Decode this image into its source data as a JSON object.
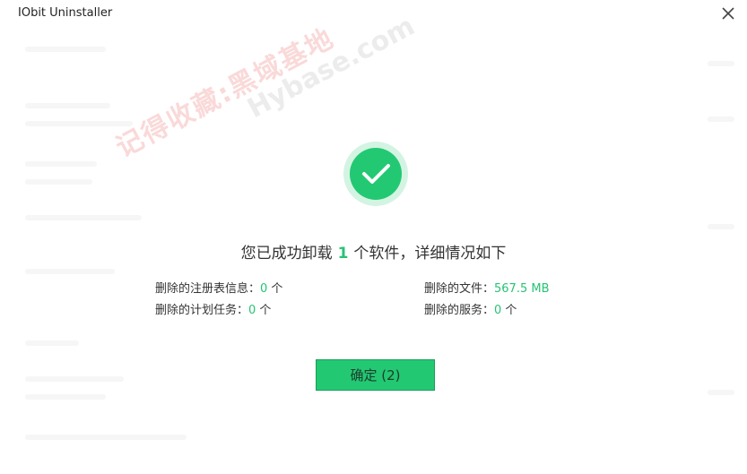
{
  "window": {
    "title": "IObit Uninstaller"
  },
  "result": {
    "prefix": "您已成功卸载",
    "count": "1",
    "suffix": "个软件，详细情况如下"
  },
  "stats": {
    "registry": {
      "label": "删除的注册表信息：",
      "value": "0",
      "unit": " 个"
    },
    "files": {
      "label": "删除的文件：",
      "value": "567.5 MB",
      "unit": ""
    },
    "tasks": {
      "label": "删除的计划任务：",
      "value": "0",
      "unit": " 个"
    },
    "services": {
      "label": "删除的服务：",
      "value": "0",
      "unit": " 个"
    }
  },
  "ok_button": {
    "label": "确定 (2)"
  },
  "watermark": {
    "cn": "记得收藏:黑域基地",
    "en": "Hybase.com"
  },
  "colors": {
    "accent": "#23c873",
    "value_text": "#27c375"
  },
  "icons": {
    "close": "close-icon",
    "success": "checkmark-circle-icon"
  }
}
